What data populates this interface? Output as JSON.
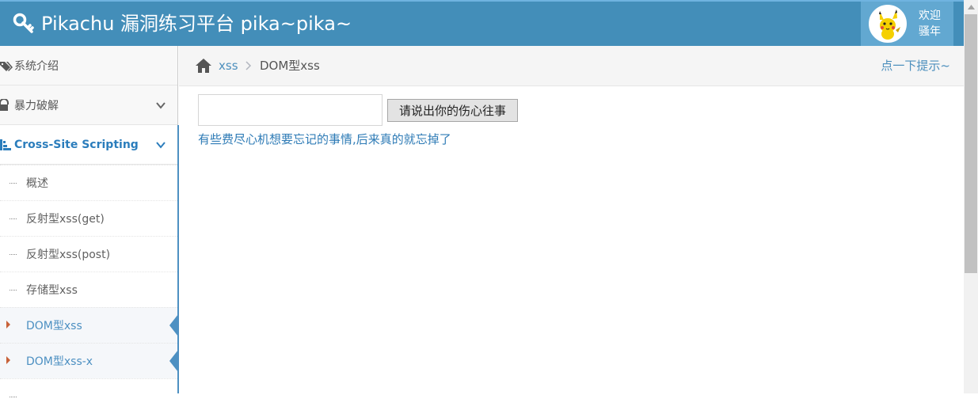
{
  "navbar": {
    "brand": "Pikachu 漏洞练习平台 pika~pika~",
    "user_greeting_line1": "欢迎",
    "user_greeting_line2": "骚年"
  },
  "sidebar": {
    "items": [
      {
        "label": "系统介绍",
        "icon": "tags-icon"
      },
      {
        "label": "暴力破解",
        "icon": "lock-icon"
      },
      {
        "label": "Cross-Site Scripting",
        "icon": "list-icon"
      }
    ],
    "subitems": [
      {
        "label": "概述"
      },
      {
        "label": "反射型xss(get)"
      },
      {
        "label": "反射型xss(post)"
      },
      {
        "label": "存储型xss"
      },
      {
        "label": "DOM型xss"
      },
      {
        "label": "DOM型xss-x"
      }
    ]
  },
  "breadcrumb": {
    "home_icon": "home-icon",
    "parent": "xss",
    "current": "DOM型xss",
    "hint": "点一下提示~"
  },
  "form": {
    "input_value": "",
    "submit_label": "请说出你的伤心往事",
    "result_link": "有些费尽心机想要忘记的事情,后来真的就忘掉了"
  },
  "colors": {
    "navbar": "#438eb9",
    "accent": "#4c8fbd",
    "active_marker": "#c86139"
  }
}
